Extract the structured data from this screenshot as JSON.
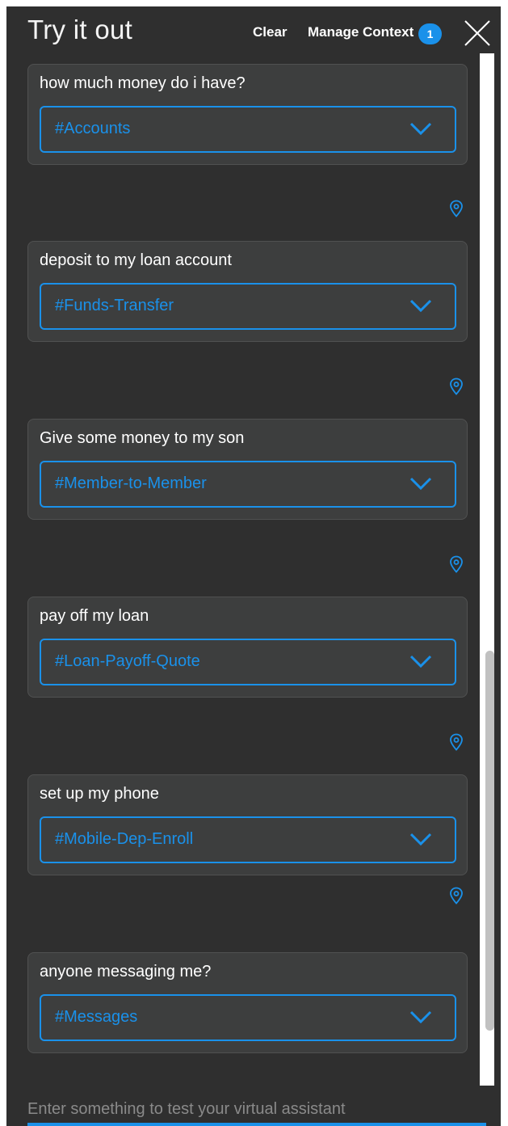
{
  "header": {
    "title": "Try it out",
    "clear_label": "Clear",
    "manage_context_label": "Manage Context",
    "context_count": "1"
  },
  "messages": [
    {
      "text": "how much money do i have?",
      "intent": "#Accounts"
    },
    {
      "text": "deposit to my loan account",
      "intent": "#Funds-Transfer"
    },
    {
      "text": "Give some money to my son",
      "intent": "#Member-to-Member"
    },
    {
      "text": "pay off my loan",
      "intent": "#Loan-Payoff-Quote"
    },
    {
      "text": "set up my phone",
      "intent": "#Mobile-Dep-Enroll"
    },
    {
      "text": "anyone messaging me?",
      "intent": "#Messages"
    }
  ],
  "input": {
    "placeholder": "Enter something to test your virtual assistant",
    "value": ""
  },
  "icons": {
    "close": "close-icon",
    "chevron": "chevron-down-icon",
    "pin": "location-pin-icon"
  },
  "colors": {
    "panel_bg": "#2f2f2f",
    "card_bg": "#3d3e3e",
    "accent": "#1a91ea",
    "text": "#ffffff"
  }
}
